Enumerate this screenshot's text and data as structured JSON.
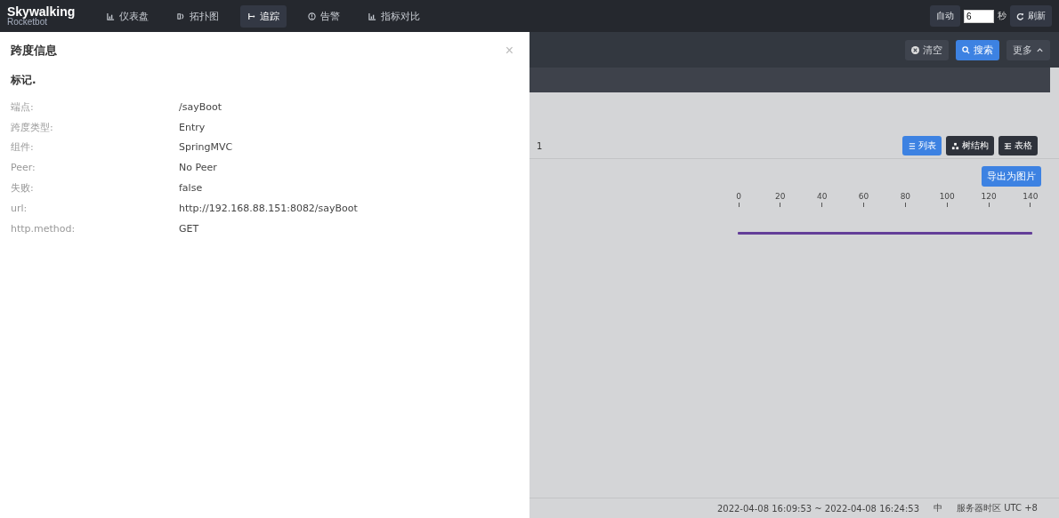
{
  "brand": {
    "name": "Skywalking",
    "subtitle": "Rocketbot"
  },
  "nav": [
    {
      "label": "仪表盘",
      "kind": "chart",
      "selected": false
    },
    {
      "label": "拓扑图",
      "kind": "topo",
      "selected": false
    },
    {
      "label": "追踪",
      "kind": "trace",
      "selected": true
    },
    {
      "label": "告警",
      "kind": "alert",
      "selected": false
    },
    {
      "label": "指标对比",
      "kind": "chart",
      "selected": false
    }
  ],
  "refresh": {
    "auto_label": "自动",
    "interval": "6",
    "unit": "秒",
    "refresh_label": "刷新"
  },
  "toolbar": {
    "clear": "清空",
    "search": "搜索",
    "more": "更多"
  },
  "trace": {
    "count": "1",
    "views": [
      {
        "label": "列表",
        "kind": "list",
        "selected": true
      },
      {
        "label": "树结构",
        "kind": "tree",
        "selected": false
      },
      {
        "label": "表格",
        "kind": "table",
        "selected": false
      }
    ],
    "export": "导出为图片",
    "axis_ticks": [
      "0",
      "20",
      "40",
      "60",
      "80",
      "100",
      "120",
      "140"
    ]
  },
  "footer": {
    "time_range": "2022-04-08 16:09:53 ~ 2022-04-08 16:24:53",
    "language": "中",
    "timezone": "服务器时区 UTC +8"
  },
  "drawer": {
    "title": "跨度信息",
    "close": "×",
    "section": "标记.",
    "fields": [
      {
        "label": "端点:",
        "value": "/sayBoot"
      },
      {
        "label": "跨度类型:",
        "value": "Entry"
      },
      {
        "label": "组件:",
        "value": "SpringMVC"
      },
      {
        "label": "Peer:",
        "value": "No Peer"
      },
      {
        "label": "失败:",
        "value": "false"
      },
      {
        "label": "url:",
        "value": "http://192.168.88.151:8082/sayBoot"
      },
      {
        "label": "http.method:",
        "value": "GET"
      }
    ]
  }
}
